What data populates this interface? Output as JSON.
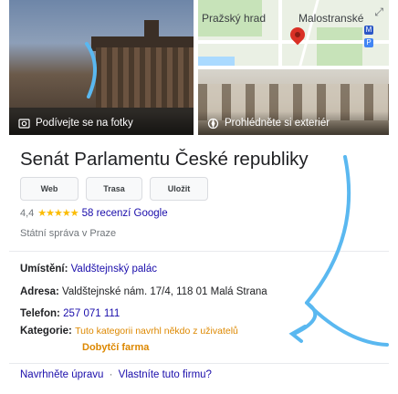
{
  "media": {
    "photos_caption": "Podívejte se na fotky",
    "exterior_caption": "Prohlédněte si exteriér",
    "map_labels": [
      "Pražský hrad",
      "Malostranské"
    ],
    "map_icons": [
      "pin-icon",
      "expand-icon",
      "metro-icon",
      "parking-icon"
    ]
  },
  "place": {
    "title": "Senát Parlamentu České republiky",
    "actions": [
      "Web",
      "Trasa",
      "Uložit"
    ],
    "rating": "4,4",
    "stars": "★★★★★",
    "reviews": "58 recenzí Google",
    "category": "Státní správa v Praze"
  },
  "details": {
    "location_label": "Umístění:",
    "location_value": "Valdštejnský palác",
    "address_label": "Adresa:",
    "address_value": "Valdštejnské nám. 17/4, 118 01 Malá Strana",
    "phone_label": "Telefon:",
    "phone_value": "257 071 111",
    "categories_label": "Kategorie:",
    "categories_note": "Tuto kategorii navrhl někdo z uživatelů",
    "categories_value": "Dobytčí farma"
  },
  "footer": {
    "suggest_edit": "Navrhněte úpravu",
    "separator": "·",
    "own_business": "Vlastníte tuto firmu?"
  },
  "colors": {
    "link": "#1a0dab",
    "annotation": "#5ab8f0",
    "star": "#fbbc04",
    "suggestion": "#dd8800"
  }
}
